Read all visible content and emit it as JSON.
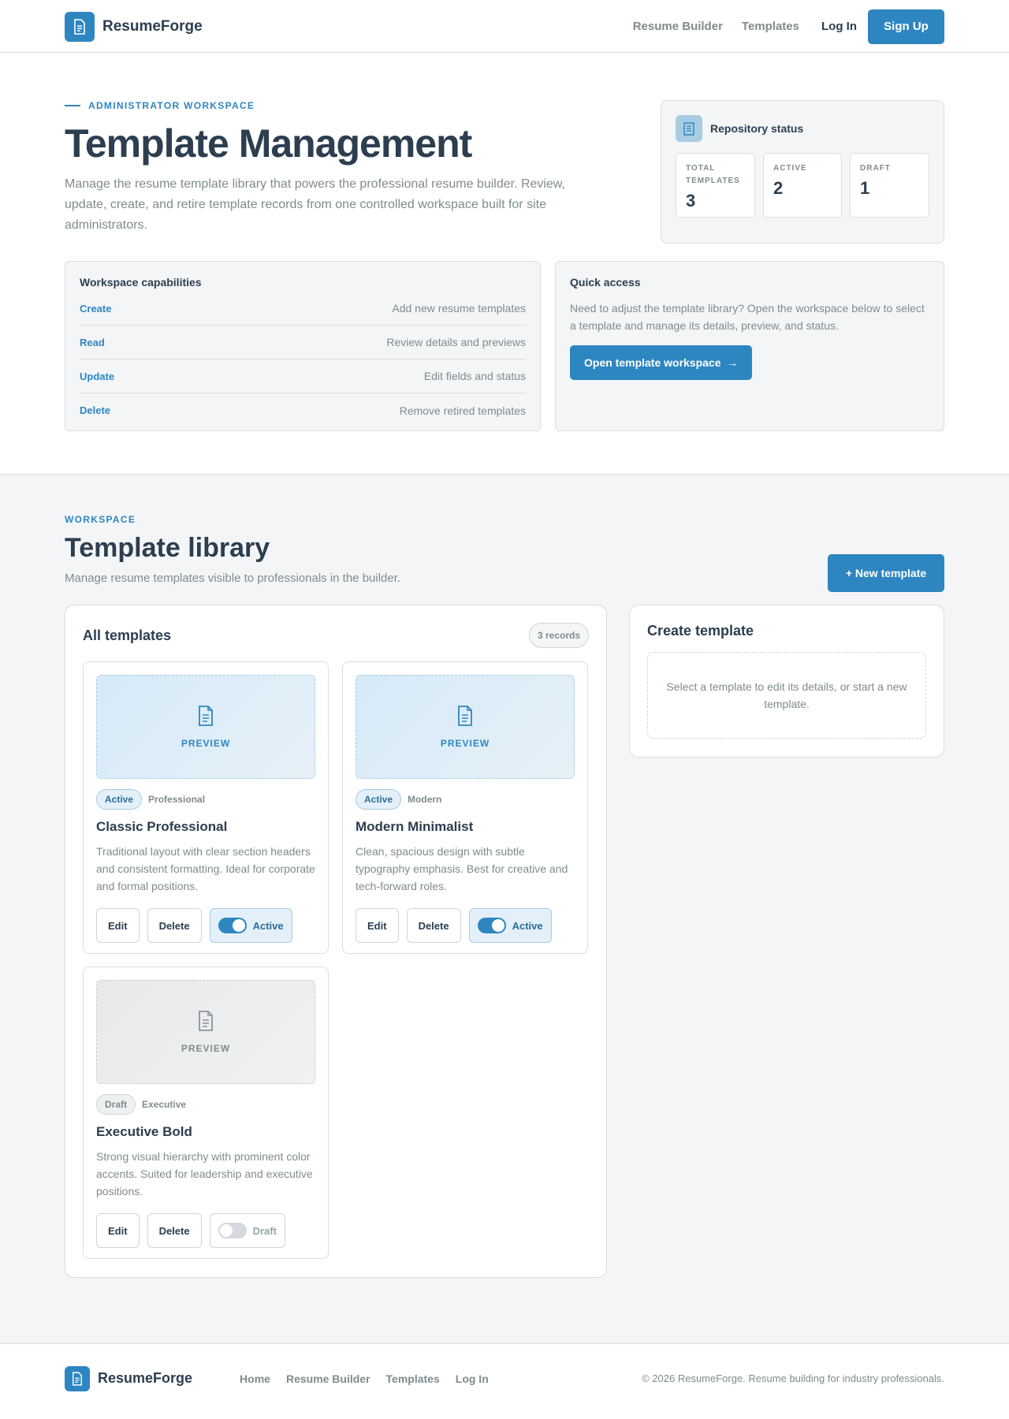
{
  "brand": {
    "name": "ResumeForge",
    "icon": "document-icon",
    "accent": "#2e86c1"
  },
  "nav": {
    "resume_builder": "Resume Builder",
    "templates": "Templates",
    "login": "Log In",
    "signup": "Sign Up"
  },
  "hero": {
    "eyebrow": "ADMINISTRATOR WORKSPACE",
    "title": "Template Management",
    "lead": "Manage the resume template library that powers the professional resume builder. Review, update, create, and retire template records from one controlled workspace built for site administrators."
  },
  "status": {
    "title": "Repository status",
    "stats": [
      {
        "label": "TOTAL TEMPLATES",
        "value": "3"
      },
      {
        "label": "ACTIVE",
        "value": "2"
      },
      {
        "label": "DRAFT",
        "value": "1"
      }
    ]
  },
  "capabilities": {
    "title": "Workspace capabilities",
    "items": [
      {
        "key": "Create",
        "value": "Add new resume templates"
      },
      {
        "key": "Read",
        "value": "Review details and previews"
      },
      {
        "key": "Update",
        "value": "Edit fields and status"
      },
      {
        "key": "Delete",
        "value": "Remove retired templates"
      }
    ]
  },
  "quick_access": {
    "title": "Quick access",
    "text": "Need to adjust the template library? Open the workspace below to select a template and manage its details, preview, and status.",
    "button": "Open template workspace",
    "button_arrow": "→"
  },
  "workspace": {
    "eyebrow": "WORKSPACE",
    "title": "Template library",
    "subtitle": "Manage resume templates visible to professionals in the builder.",
    "new_button": "+ New template"
  },
  "library": {
    "title": "All templates",
    "count": "3 records",
    "templates": [
      {
        "preview_label": "PREVIEW",
        "status": "Active",
        "category": "Professional",
        "name": "Classic Professional",
        "description": "Traditional layout with clear section headers and consistent formatting. Ideal for corporate and formal positions.",
        "edit": "Edit",
        "delete": "Delete",
        "toggle_label": "Active"
      },
      {
        "preview_label": "PREVIEW",
        "status": "Active",
        "category": "Modern",
        "name": "Modern Minimalist",
        "description": "Clean, spacious design with subtle typography emphasis. Best for creative and tech-forward roles.",
        "edit": "Edit",
        "delete": "Delete",
        "toggle_label": "Active"
      },
      {
        "preview_label": "PREVIEW",
        "status": "Draft",
        "category": "Executive",
        "name": "Executive Bold",
        "description": "Strong visual hierarchy with prominent color accents. Suited for leadership and executive positions.",
        "edit": "Edit",
        "delete": "Delete",
        "toggle_label": "Draft"
      }
    ]
  },
  "create_panel": {
    "title": "Create template",
    "empty_text": "Select a template to edit its details, or start a new template."
  },
  "footer": {
    "links": [
      "Home",
      "Resume Builder",
      "Templates",
      "Log In"
    ],
    "copyright": "© 2026 ResumeForge. Resume building for industry professionals."
  }
}
